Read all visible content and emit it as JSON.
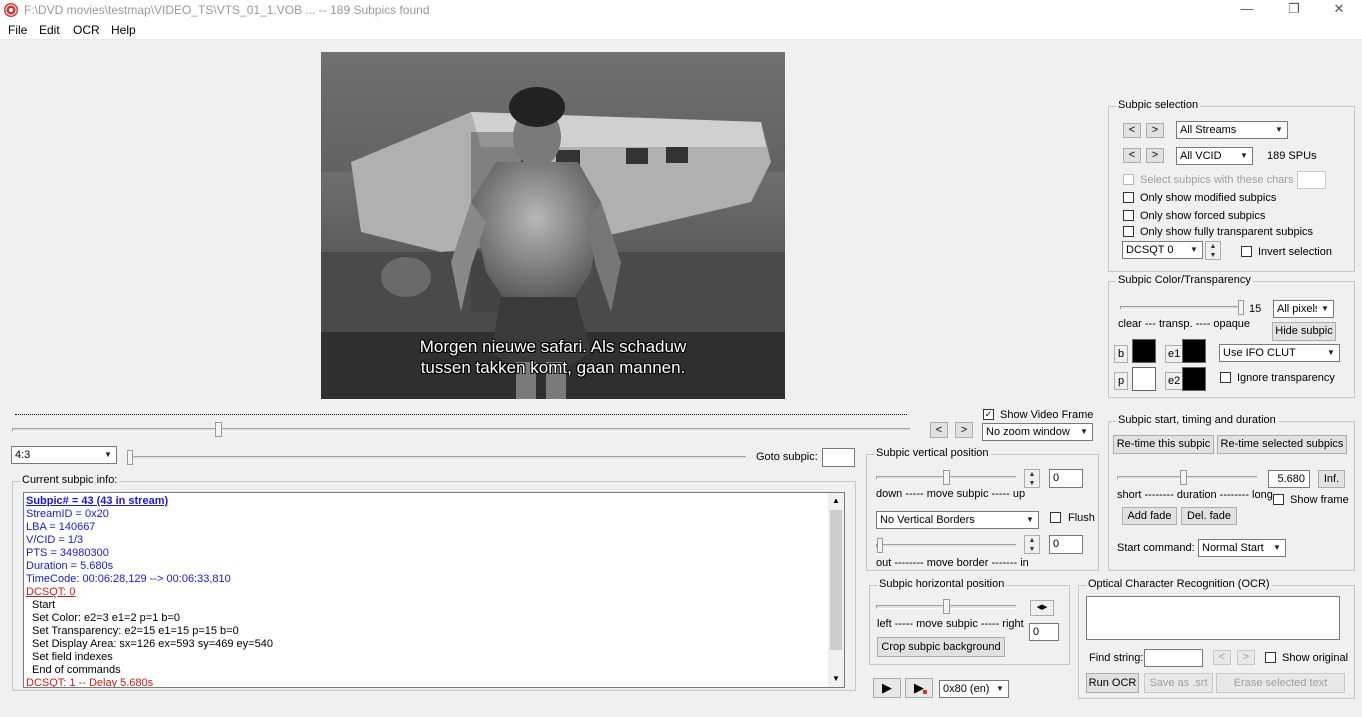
{
  "window": {
    "title": "F:\\DVD movies\\testmap\\VIDEO_TS\\VTS_01_1.VOB ... -- 189 Subpics found",
    "minimize": "—",
    "maximize": "❐",
    "close": "✕"
  },
  "menu": [
    "File",
    "Edit",
    "OCR",
    "Help"
  ],
  "video": {
    "subtitle_line1": "Morgen nieuwe safari. Als schaduw",
    "subtitle_line2": "tussen takken komt, gaan mannen."
  },
  "aspect_combo": "4:3",
  "goto_label": "Goto subpic:",
  "goto_value": "",
  "nav_prev": "<",
  "nav_next": ">",
  "show_video_frame": {
    "label": "Show Video Frame",
    "checked": "✓"
  },
  "zoom_combo": "No zoom window",
  "current_info": {
    "label": "Current subpic info:",
    "lines": [
      {
        "text": "Subpic# = 43 (43 in stream)",
        "color": "#1a1acc",
        "bold": true,
        "underline": true
      },
      {
        "text": "StreamID = 0x20",
        "color": "#1a1acc"
      },
      {
        "text": "LBA = 140667",
        "color": "#1a1acc"
      },
      {
        "text": "V/CID = 1/3",
        "color": "#1a1acc"
      },
      {
        "text": "PTS = 34980300",
        "color": "#1a1acc"
      },
      {
        "text": "Duration = 5.680s",
        "color": "#1a1acc"
      },
      {
        "text": "TimeCode: 00:06:28,129 --> 00:06:33,810",
        "color": "#1a1acc"
      },
      {
        "text": "DCSQT: 0",
        "color": "#cc1a1a",
        "underline": true
      },
      {
        "text": "Start",
        "color": "#000000",
        "indent": true
      },
      {
        "text": "Set Color: e2=3 e1=2 p=1 b=0",
        "color": "#000000",
        "indent": true
      },
      {
        "text": "Set Transparency: e2=15 e1=15 p=15 b=0",
        "color": "#000000",
        "indent": true
      },
      {
        "text": "Set Display Area: sx=126 ex=593 sy=469 ey=540",
        "color": "#000000",
        "indent": true
      },
      {
        "text": "Set field indexes",
        "color": "#000000",
        "indent": true
      },
      {
        "text": "End of commands",
        "color": "#000000",
        "indent": true
      },
      {
        "text": "DCSQT: 1 -- Delay 5.680s",
        "color": "#cc1a1a"
      }
    ]
  },
  "vertical": {
    "label": "Subpic vertical position",
    "value": "0",
    "move_label": "down ----- move subpic ----- up",
    "borders_combo": "No Vertical Borders",
    "flush": "Flush",
    "border_value": "0",
    "border_label": "out -------- move border ------- in"
  },
  "horizontal": {
    "label": "Subpic horizontal position",
    "move_label": "left ----- move subpic ----- right",
    "value": "0",
    "crop_button": "Crop subpic background"
  },
  "playback": {
    "play": "▶",
    "play_frame": "▶",
    "language_combo": "0x80 (en)"
  },
  "selection": {
    "label": "Subpic selection",
    "streams_combo": "All Streams",
    "vcid_combo": "All VCID",
    "spu_count": "189 SPUs",
    "chars_label": "Select subpics with these chars",
    "modified_label": "Only show modified subpics",
    "forced_label": "Only show forced subpics",
    "transparent_label": "Only show fully transparent subpics",
    "dcsqt_combo": "DCSQT 0",
    "invert_label": "Invert selection"
  },
  "color": {
    "label": "Subpic Color/Transparency",
    "value": "15",
    "pixels_combo": "All pixels",
    "scale_label": "clear --- transp. ---- opaque",
    "hide_button": "Hide subpic",
    "b_label": "b",
    "e1_label": "e1",
    "p_label": "p",
    "e2_label": "e2",
    "clut_combo": "Use IFO CLUT",
    "ignore_label": "Ignore transparency",
    "swatch_b": "#000000",
    "swatch_e1": "#000000",
    "swatch_p": "#ffffff",
    "swatch_e2": "#000000"
  },
  "timing": {
    "label": "Subpic start, timing and duration",
    "retime_button": "Re-time this subpic",
    "retime_sel_button": "Re-time selected subpics",
    "duration_value": "5.680",
    "inf_button": "Inf.",
    "scale_label": "short -------- duration -------- long",
    "show_frame": "Show frame",
    "add_fade": "Add fade",
    "del_fade": "Del. fade",
    "start_label": "Start command:",
    "start_combo": "Normal Start"
  },
  "ocr": {
    "label": "Optical Character Recognition (OCR)",
    "find_label": "Find string:",
    "find_value": "",
    "show_original": "Show original",
    "run_button": "Run OCR",
    "save_button": "Save as .srt",
    "erase_button": "Erase selected text"
  }
}
